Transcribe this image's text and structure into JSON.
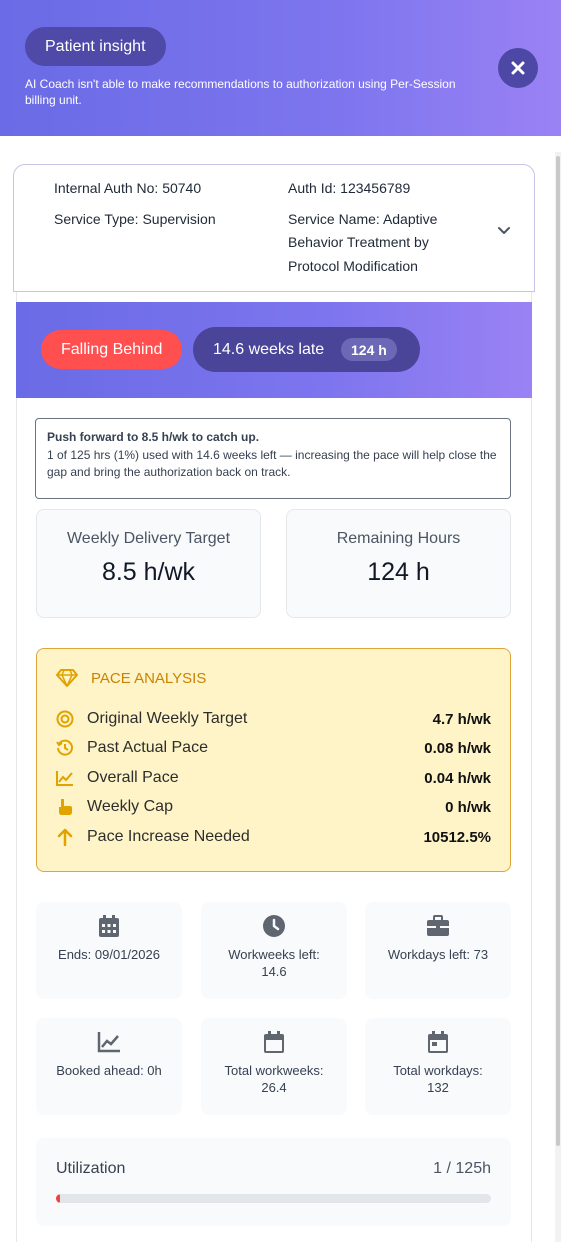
{
  "header": {
    "title": "Patient insight",
    "note": "AI Coach isn't able to make recommendations to authorization using Per-Session billing unit."
  },
  "auth": {
    "internal_auth_label": "Internal Auth No:",
    "internal_auth_value": "50740",
    "auth_id_label": "Auth Id:",
    "auth_id_value": "123456789",
    "service_type_label": "Service Type:",
    "service_type_value": "Supervision",
    "service_name_label": "Service Name:",
    "service_name_line1": "Adaptive",
    "service_name_line2": "Behavior Treatment by",
    "service_name_line3": "Protocol Modification"
  },
  "status": {
    "falling_label": "Falling Behind",
    "late_label": "14.6 weeks late",
    "late_badge": "124 h"
  },
  "push": {
    "headline": "Push forward to 8.5 h/wk to catch up.",
    "detail": "1 of 125 hrs (1%) used with 14.6 weeks left — increasing the pace will help close the gap and bring the authorization back on track."
  },
  "stats": [
    {
      "title": "Weekly Delivery Target",
      "value": "8.5 h/wk"
    },
    {
      "title": "Remaining Hours",
      "value": "124 h"
    }
  ],
  "pace": {
    "title": "PACE ANALYSIS",
    "rows": [
      {
        "icon": "target-icon",
        "label": "Original Weekly Target",
        "value": "4.7 h/wk"
      },
      {
        "icon": "history-icon",
        "label": "Past Actual Pace",
        "value": "0.08 h/wk"
      },
      {
        "icon": "trend-chart-icon",
        "label": "Overall Pace",
        "value": "0.04 h/wk"
      },
      {
        "icon": "hand-pointer-icon",
        "label": "Weekly Cap",
        "value": "0 h/wk"
      },
      {
        "icon": "arrow-up-icon",
        "label": "Pace Increase Needed",
        "value": "10512.5%"
      }
    ]
  },
  "info": [
    {
      "icon": "calendar-grid-icon",
      "line1": "Ends: 09/01/2026",
      "line2": ""
    },
    {
      "icon": "clock-icon",
      "line1": "Workweeks left:",
      "line2": "14.6"
    },
    {
      "icon": "briefcase-icon",
      "line1": "Workdays left: 73",
      "line2": ""
    },
    {
      "icon": "trend-chart-icon",
      "line1": "Booked ahead: 0h",
      "line2": ""
    },
    {
      "icon": "calendar-icon",
      "line1": "Total workweeks:",
      "line2": "26.4"
    },
    {
      "icon": "calendar-icon",
      "line1": "Total workdays:",
      "line2": "132"
    }
  ],
  "utilization": {
    "label": "Utilization",
    "value": "1 / 125h",
    "progress": 0.008
  },
  "colors": {
    "brand_gradient_start": "#6a6be6",
    "brand_gradient_end": "#9a82f4",
    "falling_behind": "#ff4f4f",
    "pace_accent": "#e0a53a",
    "progress_fill": "#ef4444"
  }
}
